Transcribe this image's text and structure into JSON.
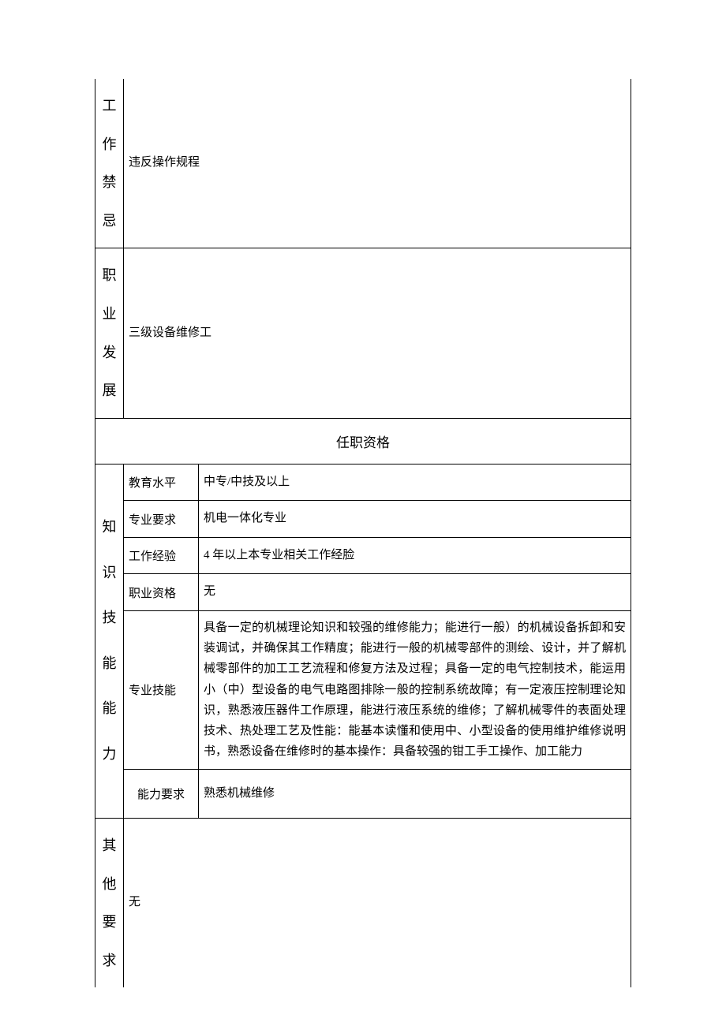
{
  "rows": {
    "work_taboo": {
      "label": "工\n作\n禁\n忌",
      "value": "违反操作规程"
    },
    "career_dev": {
      "label": "职\n业\n发\n展",
      "value": "三级设备维修工"
    }
  },
  "section_header": "任职资格",
  "qualifications": {
    "vert_label": "知\n识\n技\n能\n能\n力",
    "education": {
      "label": "教育水平",
      "value": "中专/中技及以上"
    },
    "major": {
      "label": "专业要求",
      "value": "机电一体化专业"
    },
    "experience": {
      "label": "工作经验",
      "value": "4 年以上本专业相关工作经脸"
    },
    "cert": {
      "label": "职业资格",
      "value": "无"
    },
    "skills": {
      "label": "专业技能",
      "value": "具备一定的机械理论知识和较强的维修能力；能进行一般）的机械设备拆卸和安装调试，并确保其工作精度；能进行一般的机械零部件的测绘、设计，并了解机械零部件的加工工艺流程和修复方法及过程；具备一定的电气控制技术，能运用小（中）型设备的电气电路图排除一般的控制系统故障；有一定液压控制理论知识，熟悉液压器件工作原理，能进行液压系统的维修；了解机械零件的表面处理技术、热处理工艺及性能：能基本读懂和使用中、小型设备的使用维护维修说明书，熟悉设备在维修时的基本操作：具备较强的钳工手工操作、加工能力"
    },
    "ability": {
      "label": "能力要求",
      "value": "熟悉机械维修"
    }
  },
  "other": {
    "label": "其\n他\n要\n求",
    "value": "无"
  }
}
